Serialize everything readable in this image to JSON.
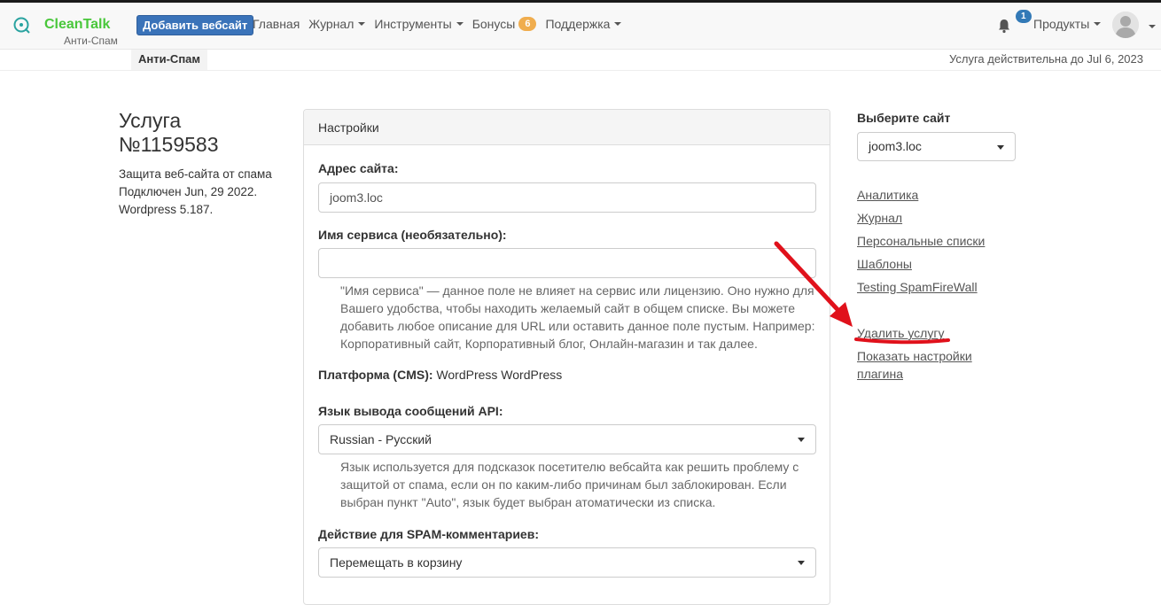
{
  "navbar": {
    "logo_name": "CleanTalk",
    "logo_sub": "Анти-Спам",
    "add_site": "Добавить вебсайт",
    "links": {
      "home": "Главная",
      "journal": "Журнал",
      "tools": "Инструменты",
      "bonuses": "Бонусы",
      "bonuses_count": "6",
      "support": "Поддержка"
    },
    "notifications_count": "1",
    "products": "Продукты"
  },
  "subbar": {
    "tab": "Анти-Спам",
    "valid_until": "Услуга действительна до Jul 6, 2023"
  },
  "service": {
    "title": "Услуга №1159583",
    "info": [
      "Защита веб-сайта от спама",
      "Подключен Jun, 29 2022.",
      "Wordpress 5.187."
    ]
  },
  "panel": {
    "heading": "Настройки",
    "site_address_label": "Адрес сайта:",
    "site_address_value": "joom3.loc",
    "service_name_label": "Имя сервиса (необязательно):",
    "service_name_value": "",
    "service_name_help": "\"Имя сервиса\" — данное поле не влияет на сервис или лицензию. Оно нужно для Вашего удобства, чтобы находить желаемый сайт в общем списке. Вы можете добавить любое описание для URL или оставить данное поле пустым. Например: Корпоративный сайт, Корпоративный блог, Онлайн-магазин и так далее.",
    "platform_label": "Платформа (CMS):",
    "platform_value": "WordPress WordPress",
    "api_lang_label": "Язык вывода сообщений API:",
    "api_lang_value": "Russian - Русский",
    "api_lang_help": "Язык используется для подсказок посетителю вебсайта как решить проблему с защитой от спама, если он по каким-либо причинам был заблокирован. Если выбран пункт \"Auto\", язык будет выбран атоматически из списка.",
    "spam_action_label": "Действие для SPAM-комментариев:",
    "spam_action_value": "Перемещать в корзину"
  },
  "sidebar": {
    "pick_label": "Выберите сайт",
    "selected_site": "joom3.loc",
    "links": {
      "analytics": "Аналитика",
      "journal": "Журнал",
      "personal_lists": "Персональные списки",
      "templates": "Шаблоны",
      "spamfirewall": "Testing SpamFireWall",
      "delete_service": "Удалить услугу",
      "plugin_settings_1": "Показать настройки",
      "plugin_settings_2": "плагина"
    }
  },
  "colors": {
    "brand_green": "#49c73b",
    "primary_blue": "#3a73b9",
    "badge_orange": "#f0ad4e",
    "annotation_red": "#e0111b"
  }
}
